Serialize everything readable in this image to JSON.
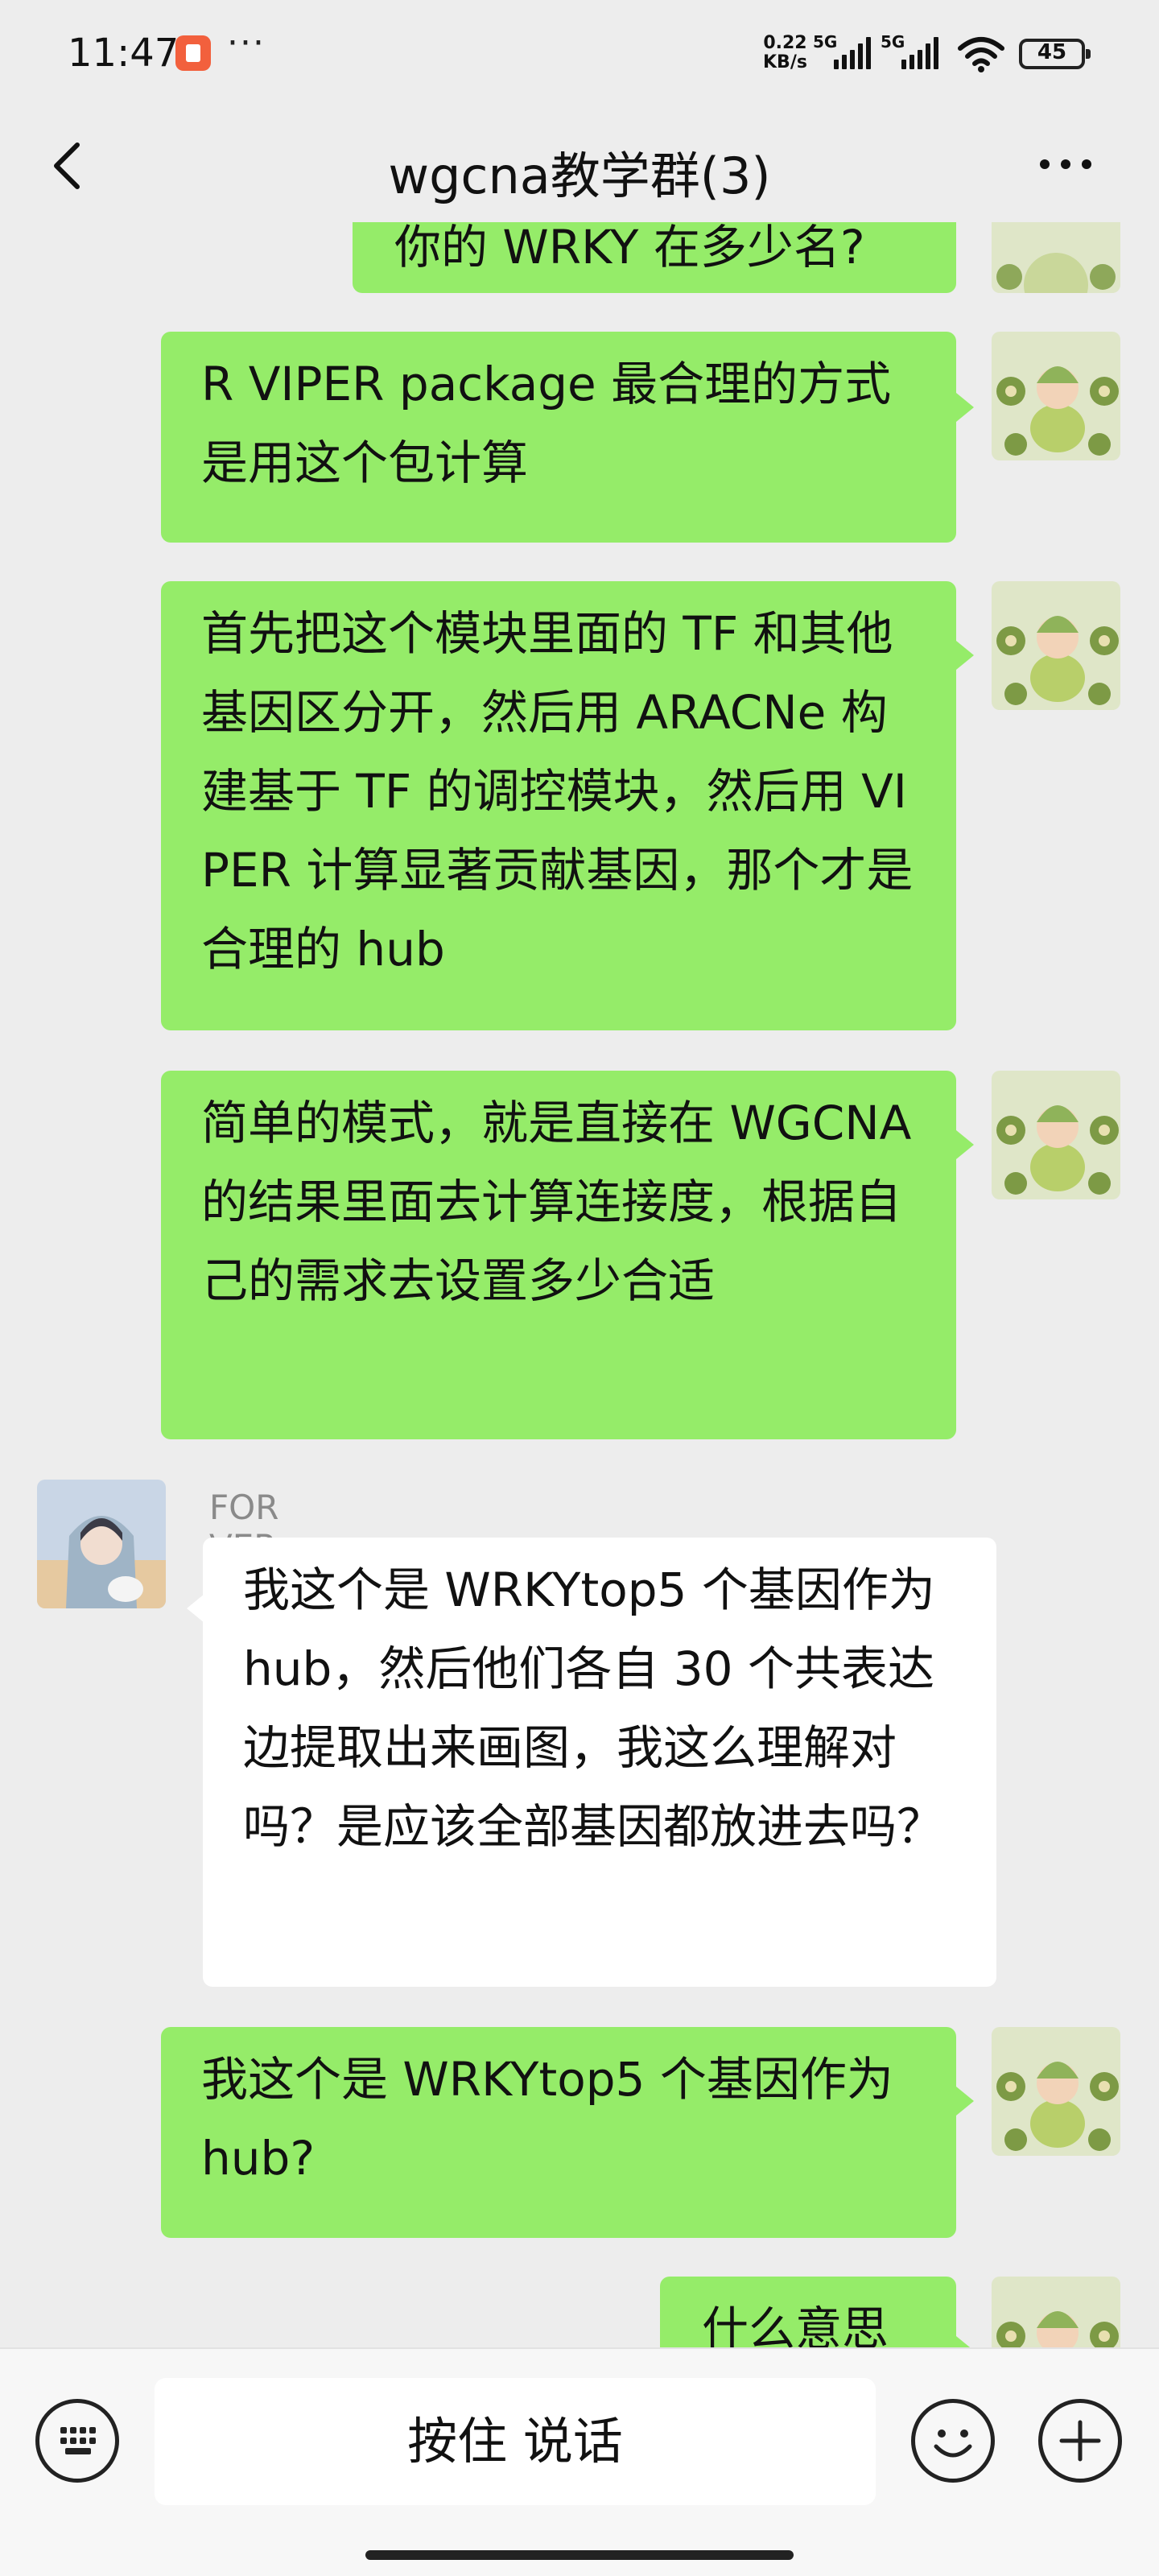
{
  "status_bar": {
    "time": "11:47",
    "more": "···",
    "net_speed_value": "0.22",
    "net_speed_unit": "KB/s",
    "signal1_label": "5G",
    "signal2_label": "5G",
    "battery": "45"
  },
  "header": {
    "title": "wgcna教学群(3)"
  },
  "messages": [
    {
      "sender": "me",
      "text": "你的 WRKY 在多少名?"
    },
    {
      "sender": "me",
      "text": "R VIPER package 最合理的方式是用这个包计算"
    },
    {
      "sender": "me",
      "text": "首先把这个模块里面的 TF 和其他基因区分开，然后用 ARACNe 构建基于 TF 的调控模块，然后用 VIPER 计算显著贡献基因，那个才是合理的 hub"
    },
    {
      "sender": "me",
      "text": "简单的模式，就是直接在 WGCNA 的结果里面去计算连接度，根据自己的需求去设置多少合适"
    },
    {
      "sender": "FOR VER",
      "text": "我这个是 WRKYtop5 个基因作为 hub，然后他们各自 30 个共表达边提取出来画图，我这么理解对吗？是应该全部基因都放进去吗？"
    },
    {
      "sender": "me",
      "text": "我这个是 WRKYtop5 个基因作为 hub?"
    },
    {
      "sender": "me",
      "text": "什么意思"
    }
  ],
  "input_bar": {
    "hold_to_talk": "按住 说话"
  },
  "colors": {
    "background": "#ededed",
    "my_bubble": "#95ec69",
    "other_bubble": "#ffffff"
  },
  "icons": [
    "back-icon",
    "more-icon",
    "keyboard-icon",
    "emoji-icon",
    "plus-icon",
    "wifi-icon",
    "signal-icon",
    "battery-icon"
  ]
}
